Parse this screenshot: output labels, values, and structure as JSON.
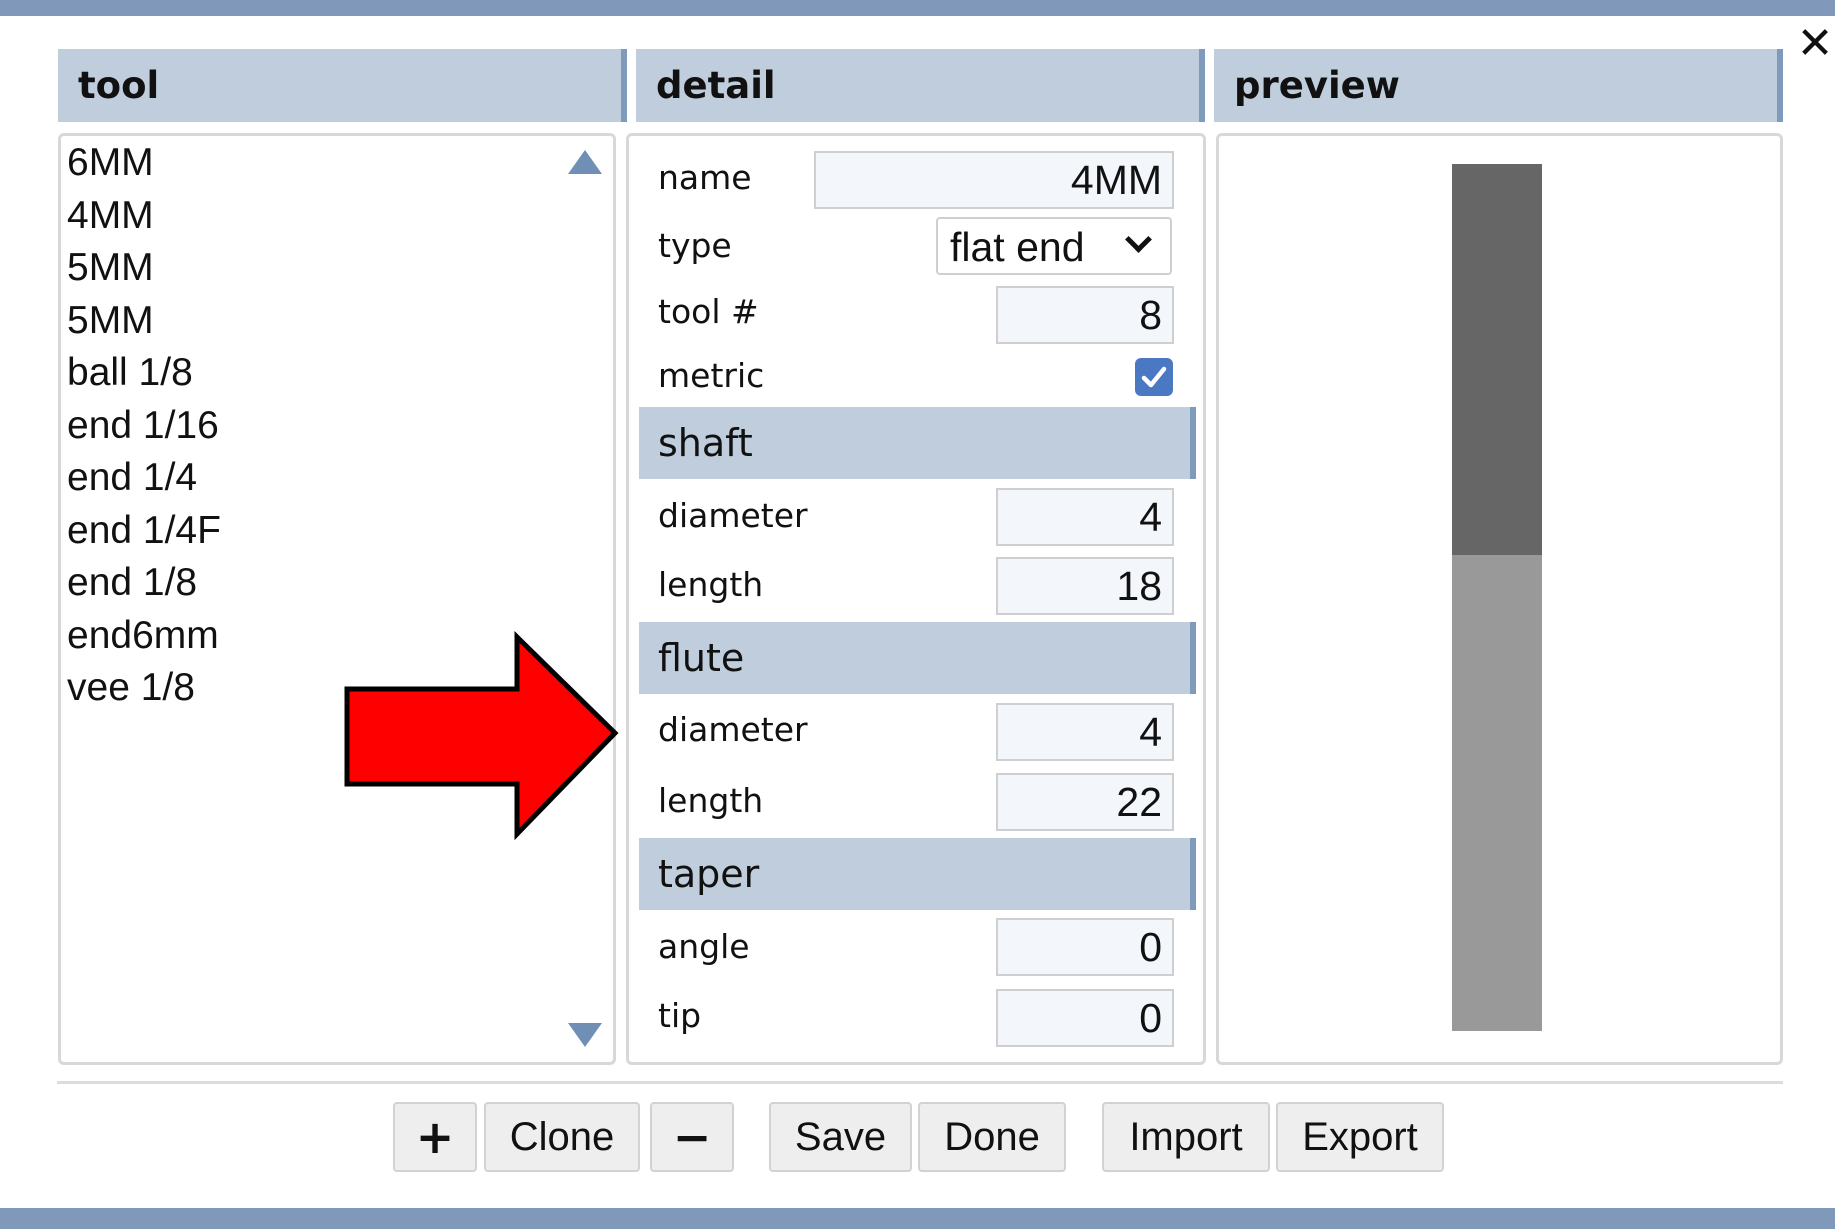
{
  "window": {
    "close_glyph": "✕"
  },
  "columns": {
    "tool": "tool",
    "detail": "detail",
    "preview": "preview"
  },
  "tool_list": [
    "6MM",
    "4MM",
    "5MM",
    "5MM",
    "ball 1/8",
    "end 1/16",
    "end 1/4",
    "end 1/4F",
    "end 1/8",
    "end6mm",
    "vee 1/8"
  ],
  "detail": {
    "name_label": "name",
    "name_value": "4MM",
    "type_label": "type",
    "type_value": "flat end",
    "tool_num_label": "tool #",
    "tool_num_value": "8",
    "metric_label": "metric",
    "metric_checked": true,
    "shaft": {
      "title": "shaft",
      "diameter_label": "diameter",
      "diameter_value": "4",
      "length_label": "length",
      "length_value": "18"
    },
    "flute": {
      "title": "flute",
      "diameter_label": "diameter",
      "diameter_value": "4",
      "length_label": "length",
      "length_value": "22"
    },
    "taper": {
      "title": "taper",
      "angle_label": "angle",
      "angle_value": "0",
      "tip_label": "tip",
      "tip_value": "0"
    }
  },
  "preview": {
    "shaft_color": "#666666",
    "flute_color": "#999999"
  },
  "buttons": {
    "add": "+",
    "clone": "Clone",
    "remove": "−",
    "save": "Save",
    "done": "Done",
    "import": "Import",
    "export": "Export"
  },
  "annotation": {
    "arrow_color": "#ff0000"
  },
  "colors": {
    "header_bg": "#bfcddd",
    "accent": "#7f9bbb",
    "frame_band": "#8099bb"
  }
}
